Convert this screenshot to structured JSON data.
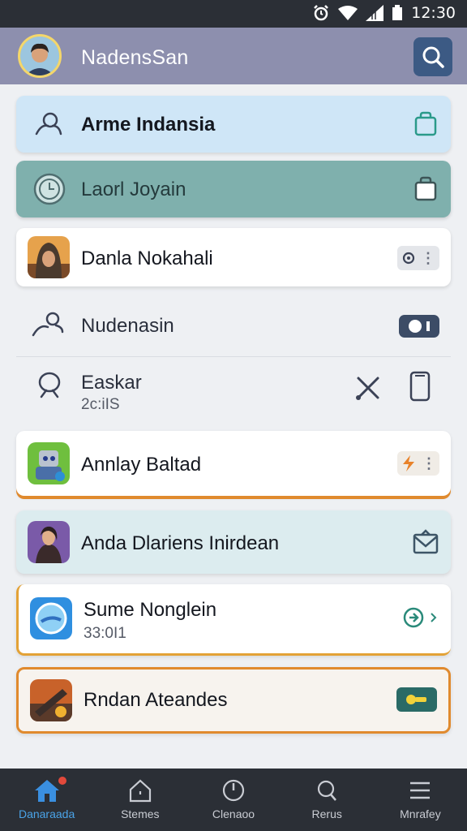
{
  "status_bar": {
    "time": "12:30",
    "icons": [
      "alarm-icon",
      "wifi-icon",
      "signal-icon",
      "battery-icon"
    ]
  },
  "app_bar": {
    "title": "NadensSan",
    "avatar_icon": "user-avatar",
    "search_icon": "search-icon"
  },
  "list": [
    {
      "label": "Arme Indansia",
      "lead_icon": "person-outline-icon",
      "trail_icon": "bag-icon"
    },
    {
      "label": "Laorl Joyain",
      "lead_icon": "clock-circle-icon",
      "trail_icon": "bag-icon"
    },
    {
      "label": "Danla Nokahali",
      "lead_icon": "hooded-character-app-icon",
      "trail_icon": "settings-pill-icon"
    },
    {
      "label": "Nudenasin",
      "lead_icon": "person-outline-icon",
      "trail_icon": "toggle-icon"
    },
    {
      "label": "Easkar",
      "sub": "2c:iIS",
      "lead_icon": "person-outline-icon",
      "trail_icons": [
        "close-x-icon",
        "phone-icon"
      ]
    },
    {
      "label": "Annlay Baltad",
      "lead_icon": "robot-app-icon",
      "trail_icon": "lightning-pill-icon"
    },
    {
      "label": "Anda Dlariens Inirdean",
      "lead_icon": "warrior-app-icon",
      "trail_icon": "mail-icon"
    },
    {
      "label": "Sume Nonglein",
      "sub": "33:0I1",
      "lead_icon": "blue-circle-app-icon",
      "trail_icon": "arrow-circle-icon"
    },
    {
      "label": "Rndan Ateandes",
      "lead_icon": "battle-app-icon",
      "trail_icon": "key-pill-icon"
    }
  ],
  "bottom_nav": [
    {
      "label": "Danaraada",
      "icon": "home-icon",
      "active": true,
      "badge": true
    },
    {
      "label": "Stemes",
      "icon": "house-outline-icon",
      "active": false
    },
    {
      "label": "Clenaoo",
      "icon": "power-icon",
      "active": false
    },
    {
      "label": "Rerus",
      "icon": "search-outline-icon",
      "active": false
    },
    {
      "label": "Mnrafey",
      "icon": "menu-icon",
      "active": false
    }
  ],
  "colors": {
    "app_bar": "#8d8fae",
    "accent_orange": "#e08a2e",
    "active_nav": "#4aa3e8",
    "row_blue": "#cfe6f7",
    "row_teal": "#7fb0ad"
  }
}
